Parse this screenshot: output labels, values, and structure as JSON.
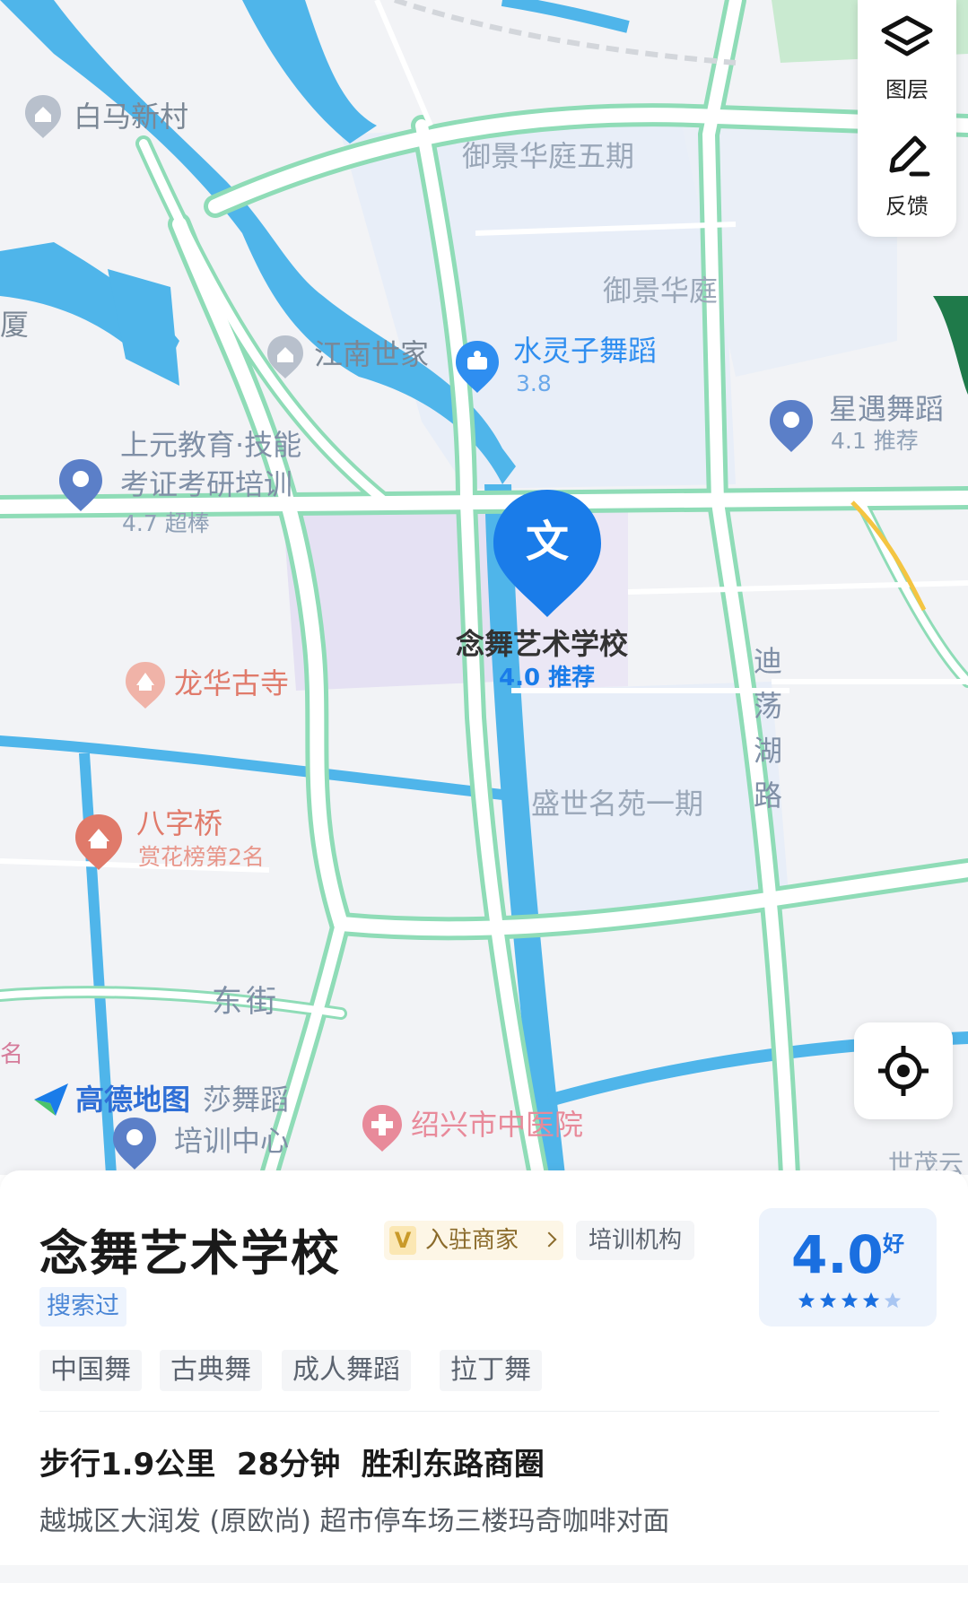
{
  "map": {
    "logo_text": "高德地图",
    "labels": {
      "baima": "白马新村",
      "yujing5": "御景华庭五期",
      "yujing": "御景华庭",
      "xia": "厦",
      "jiangnan": "江南世家",
      "shuilingzi": "水灵子舞蹈",
      "shuilingzi_rating": "3.8",
      "xingyu": "星遇舞蹈",
      "xingyu_rating": "4.1 推荐",
      "shangyuan_line1": "上元教育·技能",
      "shangyuan_line2": "考证考研培训",
      "shangyuan_rating": "4.7 超棒",
      "main_poi": "念舞艺术学校",
      "main_poi_rating": "4.0 推荐",
      "main_pin_glyph": "文",
      "longhua": "龙华古寺",
      "dihuhu_road": "迪荡湖路",
      "shengshi": "盛世名苑一期",
      "bazi": "八字桥",
      "bazi_sub": "赏花榜第2名",
      "dongjie": "东街",
      "ming": "名",
      "sha_line1": "莎舞蹈",
      "sha_line2": "培训中心",
      "hospital": "绍兴市中医院",
      "cut_bottom_right": "世茂云"
    },
    "controls": {
      "layers_label": "图层",
      "feedback_label": "反馈",
      "layers_icon": "layers-icon",
      "feedback_icon": "pencil-icon",
      "locate_icon": "locate-icon"
    },
    "colors": {
      "land": "#f2f3f6",
      "water": "#4fb5ea",
      "road_outline": "#8fdcb7",
      "road_fill": "#ffffff",
      "residential": "#e8eef8",
      "school": "#e5e1f3",
      "accent_blue": "#1a7ce9",
      "temple": "#e07a6a"
    }
  },
  "panel": {
    "title": "念舞艺术学校",
    "merchant_v": "V",
    "merchant_badge": "入驻商家",
    "category": "培训机构",
    "searched": "搜索过",
    "rating_value": "4.0",
    "rating_word": "好",
    "stars": 4,
    "tags": [
      "中国舞",
      "古典舞",
      "成人舞蹈",
      "拉丁舞"
    ],
    "distance_line": "步行1.9公里  28分钟  胜利东路商圈",
    "address": "越城区大润发 (原欧尚) 超市停车场三楼玛奇咖啡对面"
  }
}
